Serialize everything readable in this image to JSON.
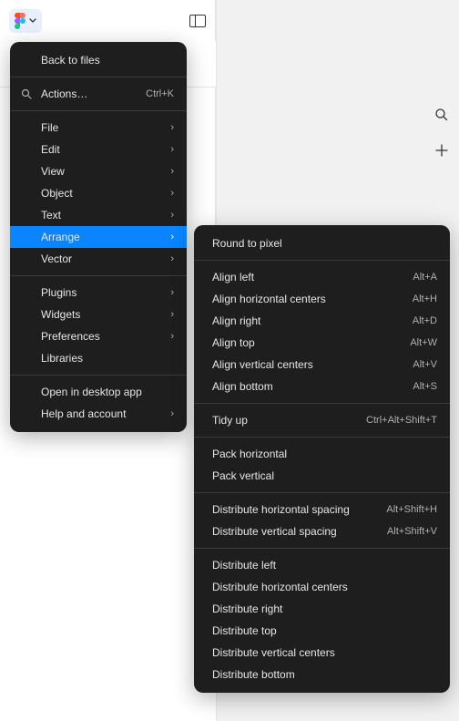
{
  "topMenu": {
    "back": "Back to files",
    "actions": "Actions…",
    "actionsShortcut": "Ctrl+K",
    "file": "File",
    "edit": "Edit",
    "view": "View",
    "object": "Object",
    "text": "Text",
    "arrange": "Arrange",
    "vector": "Vector",
    "plugins": "Plugins",
    "widgets": "Widgets",
    "preferences": "Preferences",
    "libraries": "Libraries",
    "openDesktop": "Open in desktop app",
    "helpAccount": "Help and account"
  },
  "arrangeMenu": {
    "roundPixel": "Round to pixel",
    "alignLeft": {
      "label": "Align left",
      "shortcut": "Alt+A"
    },
    "alignHCenters": {
      "label": "Align horizontal centers",
      "shortcut": "Alt+H"
    },
    "alignRight": {
      "label": "Align right",
      "shortcut": "Alt+D"
    },
    "alignTop": {
      "label": "Align top",
      "shortcut": "Alt+W"
    },
    "alignVCenters": {
      "label": "Align vertical centers",
      "shortcut": "Alt+V"
    },
    "alignBottom": {
      "label": "Align bottom",
      "shortcut": "Alt+S"
    },
    "tidyUp": {
      "label": "Tidy up",
      "shortcut": "Ctrl+Alt+Shift+T"
    },
    "packH": "Pack horizontal",
    "packV": "Pack vertical",
    "distHSpacing": {
      "label": "Distribute horizontal spacing",
      "shortcut": "Alt+Shift+H"
    },
    "distVSpacing": {
      "label": "Distribute vertical spacing",
      "shortcut": "Alt+Shift+V"
    },
    "distLeft": "Distribute left",
    "distHCenters": "Distribute horizontal centers",
    "distRight": "Distribute right",
    "distTop": "Distribute top",
    "distVCenters": "Distribute vertical centers",
    "distBottom": "Distribute bottom"
  }
}
